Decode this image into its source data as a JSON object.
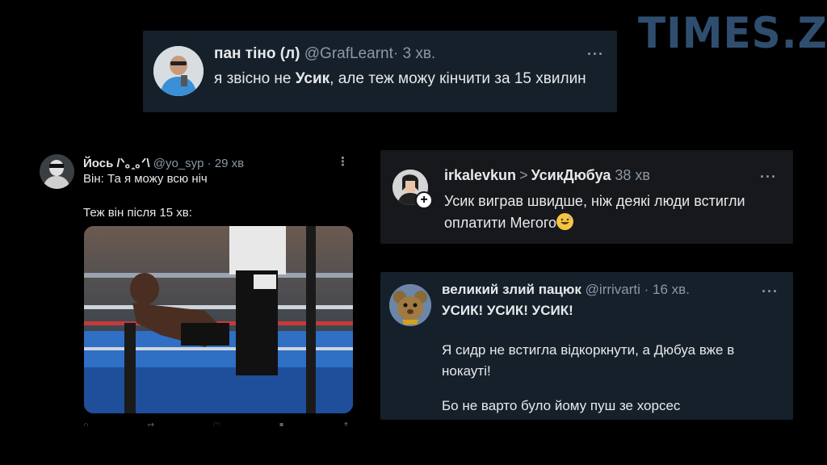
{
  "logo": {
    "text": "TIMES.ZT",
    "color": "#2f4e6f"
  },
  "tweets": [
    {
      "name": "пан тіно (л)",
      "handle": "@GrafLearnt",
      "time": "· 3 хв.",
      "text_pre": "я звісно не ",
      "text_bold": "Усик",
      "text_post": ", але теж можу кінчити за 15 хвилин",
      "more_icon": "more-horizontal-icon"
    },
    {
      "name": "Йось /ᐠ｡ꞈ｡ᐟ\\",
      "handle": "@yo_syp",
      "time": "· 29 хв",
      "line1": "Він: Та я можу всю ніч",
      "line2": "Теж він після 15 хв:",
      "media": "boxing-knockdown-image",
      "actions": [
        "reply-icon",
        "retweet-icon",
        "like-icon",
        "views-icon",
        "share-icon"
      ]
    },
    {
      "name": "irkalevkun",
      "chevron": ">",
      "community": "УсикДюбуа",
      "time": "38 хв",
      "text": "Усик виграв швидше, ніж деякі люди встигли оплатити Мегого",
      "emoji": "grinning-sweat-emoji",
      "follow_icon": "plus-icon"
    },
    {
      "name": "великий злий пацюк",
      "handle": "@irrivarti",
      "time": "· 16 хв.",
      "line1": "УСИК! УСИК! УСИК!",
      "line2": "Я сидр не встигла відкоркнути, а Дюбуа вже в нокауті!",
      "line3": "Бо не варто було йому пуш зе хорсес"
    }
  ],
  "colors": {
    "navy_card": "#15202b",
    "gray_card": "#16181c",
    "muted": "#8b98a5",
    "text": "#e7e9ea"
  }
}
